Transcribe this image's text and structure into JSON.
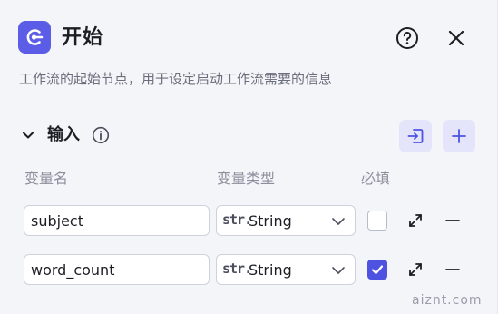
{
  "header": {
    "icon": "start-node-icon",
    "title": "开始",
    "help_icon": "help-circle-icon",
    "close_icon": "close-icon"
  },
  "description": "工作流的起始节点，用于设定启动工作流需要的信息",
  "inputs_section": {
    "title": "输入",
    "toggle_icon": "chevron-down-icon",
    "info_icon": "info-icon",
    "import_icon": "import-icon",
    "add_icon": "plus-icon",
    "columns": {
      "name": "变量名",
      "type": "变量类型",
      "required": "必填"
    },
    "rows": [
      {
        "name": "subject",
        "type_prefix": "str.",
        "type": "String",
        "required": false
      },
      {
        "name": "word_count",
        "type_prefix": "str.",
        "type": "String",
        "required": true
      }
    ]
  },
  "colors": {
    "accent": "#4d53e0",
    "icon_bg": "#5b5de6",
    "button_bg": "#e4e5fb"
  },
  "watermark": "aiznt.com"
}
